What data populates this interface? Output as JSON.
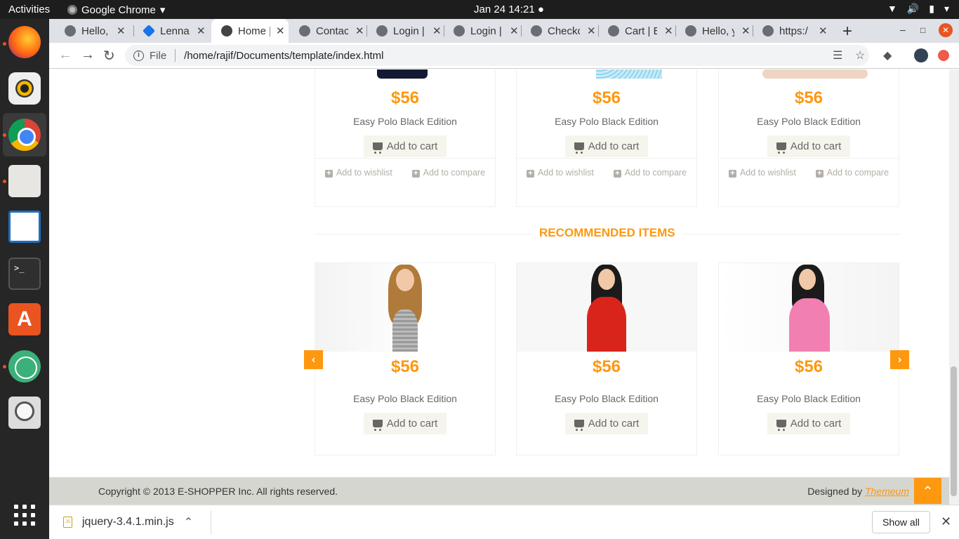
{
  "topbar": {
    "activities": "Activities",
    "app_name": "Google Chrome",
    "clock": "Jan 24  14:21 ●"
  },
  "tabs": [
    {
      "label": "Hello, у",
      "icon": "globe-icon"
    },
    {
      "label": "Lenna",
      "icon": "lenna-icon"
    },
    {
      "label": "Home |",
      "icon": "globe-icon",
      "active": true
    },
    {
      "label": "Contac",
      "icon": "globe-icon"
    },
    {
      "label": "Login |",
      "icon": "globe-icon"
    },
    {
      "label": "Login |",
      "icon": "globe-icon"
    },
    {
      "label": "Checko",
      "icon": "globe-icon"
    },
    {
      "label": "Cart | E",
      "icon": "globe-icon"
    },
    {
      "label": "Hello, у",
      "icon": "globe-icon"
    },
    {
      "label": "https:/",
      "icon": "globe-icon"
    }
  ],
  "omnibox": {
    "scheme": "File",
    "url": "/home/rajif/Documents/template/index.html"
  },
  "top_products": [
    {
      "price": "$56",
      "name": "Easy Polo Black Edition",
      "cart": "Add to cart",
      "wishlist": "Add to wishlist",
      "compare": "Add to compare"
    },
    {
      "price": "$56",
      "name": "Easy Polo Black Edition",
      "cart": "Add to cart",
      "wishlist": "Add to wishlist",
      "compare": "Add to compare"
    },
    {
      "price": "$56",
      "name": "Easy Polo Black Edition",
      "cart": "Add to cart",
      "wishlist": "Add to wishlist",
      "compare": "Add to compare"
    }
  ],
  "recommended": {
    "title": "RECOMMENDED ITEMS",
    "items": [
      {
        "price": "$56",
        "name": "Easy Polo Black Edition",
        "cart": "Add to cart"
      },
      {
        "price": "$56",
        "name": "Easy Polo Black Edition",
        "cart": "Add to cart"
      },
      {
        "price": "$56",
        "name": "Easy Polo Black Edition",
        "cart": "Add to cart"
      }
    ]
  },
  "footer": {
    "copyright": "Copyright © 2013 E-SHOPPER Inc. All rights reserved.",
    "designed_by": "Designed by ",
    "designer": "Themeum"
  },
  "download_bar": {
    "file": "jquery-3.4.1.min.js",
    "show_all": "Show all"
  },
  "colors": {
    "accent": "#fe980f",
    "footer_bg": "#d6d6d0",
    "cart_button_bg": "#f5f5ed"
  }
}
